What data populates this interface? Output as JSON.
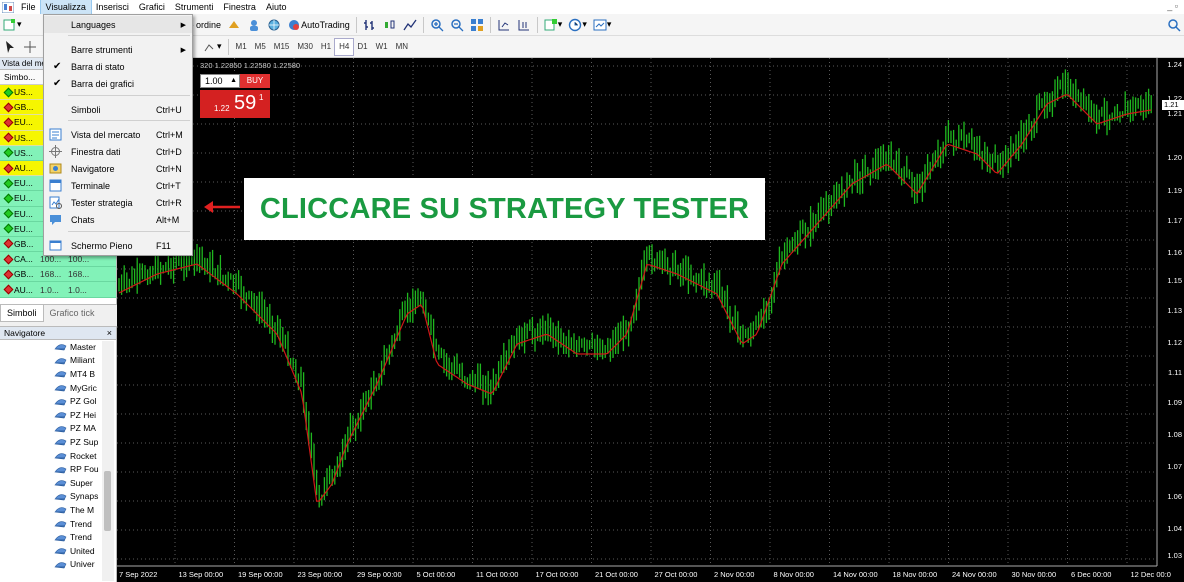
{
  "menubar": {
    "items": [
      "File",
      "Visualizza",
      "Inserisci",
      "Grafici",
      "Strumenti",
      "Finestra",
      "Aiuto"
    ],
    "active_index": 1
  },
  "toolbar": {
    "new_order_label": "Nuovo ordine",
    "autotrading_label": "AutoTrading",
    "timeframes": [
      "M1",
      "M5",
      "M15",
      "M30",
      "H1",
      "H4",
      "D1",
      "W1",
      "MN"
    ],
    "selected_timeframe": "H4"
  },
  "market_watch": {
    "title": "Vista del mercato",
    "header": "Simbo...",
    "rows": [
      {
        "sym": "US...",
        "bid": "",
        "ask": "",
        "color": "yellow",
        "dir": "up"
      },
      {
        "sym": "GB...",
        "bid": "",
        "ask": "",
        "color": "yellow",
        "dir": "down"
      },
      {
        "sym": "EU...",
        "bid": "",
        "ask": "",
        "color": "yellow",
        "dir": "down"
      },
      {
        "sym": "US...",
        "bid": "",
        "ask": "",
        "color": "yellow",
        "dir": "down"
      },
      {
        "sym": "US...",
        "bid": "",
        "ask": "",
        "color": "green",
        "dir": "up"
      },
      {
        "sym": "AU...",
        "bid": "",
        "ask": "",
        "color": "yellow",
        "dir": "down"
      },
      {
        "sym": "EU...",
        "bid": "",
        "ask": "",
        "color": "green",
        "dir": "up"
      },
      {
        "sym": "EU...",
        "bid": "",
        "ask": "",
        "color": "green",
        "dir": "up"
      },
      {
        "sym": "EU...",
        "bid": "",
        "ask": "",
        "color": "green",
        "dir": "up"
      },
      {
        "sym": "EU...",
        "bid": "",
        "ask": "",
        "color": "green",
        "dir": "up"
      },
      {
        "sym": "GB...",
        "bid": "",
        "ask": "",
        "color": "green",
        "dir": "down"
      },
      {
        "sym": "CA...",
        "bid": "100...",
        "ask": "100...",
        "color": "green",
        "dir": "down"
      },
      {
        "sym": "GB...",
        "bid": "168...",
        "ask": "168...",
        "color": "green",
        "dir": "down"
      },
      {
        "sym": "AU...",
        "bid": "1.0...",
        "ask": "1.0...",
        "color": "green",
        "dir": "down"
      }
    ],
    "tabs": [
      "Simboli",
      "Grafico tick"
    ]
  },
  "navigator": {
    "title": "Navigatore",
    "close": "×",
    "items": [
      "Master",
      "Miliant",
      "MT4 B",
      "MyGric",
      "PZ Gol",
      "PZ Hei",
      "PZ MA",
      "PZ Sup",
      "Rocket",
      "RP Fou",
      "Super",
      "Synaps",
      "The M",
      "Trend",
      "Trend",
      "United",
      "Univer"
    ]
  },
  "view_menu": {
    "items": [
      {
        "label": "Languages",
        "shortcut": "",
        "submenu": true,
        "icon": "",
        "check": false
      },
      {
        "label": "Barre strumenti",
        "shortcut": "",
        "submenu": true,
        "icon": "",
        "check": false
      },
      {
        "label": "Barra di stato",
        "shortcut": "",
        "submenu": false,
        "icon": "",
        "check": true
      },
      {
        "label": "Barra dei grafici",
        "shortcut": "",
        "submenu": false,
        "icon": "",
        "check": true
      },
      {
        "label": "Simboli",
        "shortcut": "Ctrl+U",
        "submenu": false,
        "icon": "",
        "check": false
      },
      {
        "label": "Vista del mercato",
        "shortcut": "Ctrl+M",
        "submenu": false,
        "icon": "market-watch-icon",
        "check": false
      },
      {
        "label": "Finestra dati",
        "shortcut": "Ctrl+D",
        "submenu": false,
        "icon": "crosshair-icon",
        "check": false
      },
      {
        "label": "Navigatore",
        "shortcut": "Ctrl+N",
        "submenu": false,
        "icon": "navigator-icon",
        "check": false
      },
      {
        "label": "Terminale",
        "shortcut": "Ctrl+T",
        "submenu": false,
        "icon": "terminal-icon",
        "check": false
      },
      {
        "label": "Tester strategia",
        "shortcut": "Ctrl+R",
        "submenu": false,
        "icon": "strategy-tester-icon",
        "check": false
      },
      {
        "label": "Chats",
        "shortcut": "Alt+M",
        "submenu": false,
        "icon": "chat-icon",
        "check": false
      },
      {
        "label": "Schermo Pieno",
        "shortcut": "F11",
        "submenu": false,
        "icon": "fullscreen-icon",
        "check": false
      }
    ]
  },
  "one_click": {
    "header": "320 1.22850 1.22580 1.22580",
    "lot": "1.00",
    "buy": "BUY",
    "price_small": "1.22",
    "price_big": "59",
    "price_sup": "1"
  },
  "callout": {
    "text": "CLICCARE SU STRATEGY TESTER"
  },
  "chart_axis": {
    "price_labels": [
      "1.24",
      "1.22",
      "1.21",
      "1.20",
      "1.19",
      "1.17",
      "1.16",
      "1.15",
      "1.13",
      "1.12",
      "1.11",
      "1.09",
      "1.08",
      "1.07",
      "1.06",
      "1.04",
      "1.03"
    ],
    "current_price": "1.21",
    "date_labels": [
      "7 Sep 2022",
      "13 Sep 00:00",
      "19 Sep 00:00",
      "23 Sep 00:00",
      "29 Sep 00:00",
      "5 Oct 00:00",
      "11 Oct 00:00",
      "17 Oct 00:00",
      "21 Oct 00:00",
      "27 Oct 00:00",
      "2 Nov 00:00",
      "8 Nov 00:00",
      "14 Nov 00:00",
      "18 Nov 00:00",
      "24 Nov 00:00",
      "30 Nov 00:00",
      "6 Dec 00:00",
      "12 Dec 00:0"
    ]
  },
  "colors": {
    "candles": "#1fb81f",
    "moving_average": "#d01818",
    "callout_text": "#1a9a41",
    "arrow": "#e02020",
    "grid": "#5a5a5a"
  }
}
